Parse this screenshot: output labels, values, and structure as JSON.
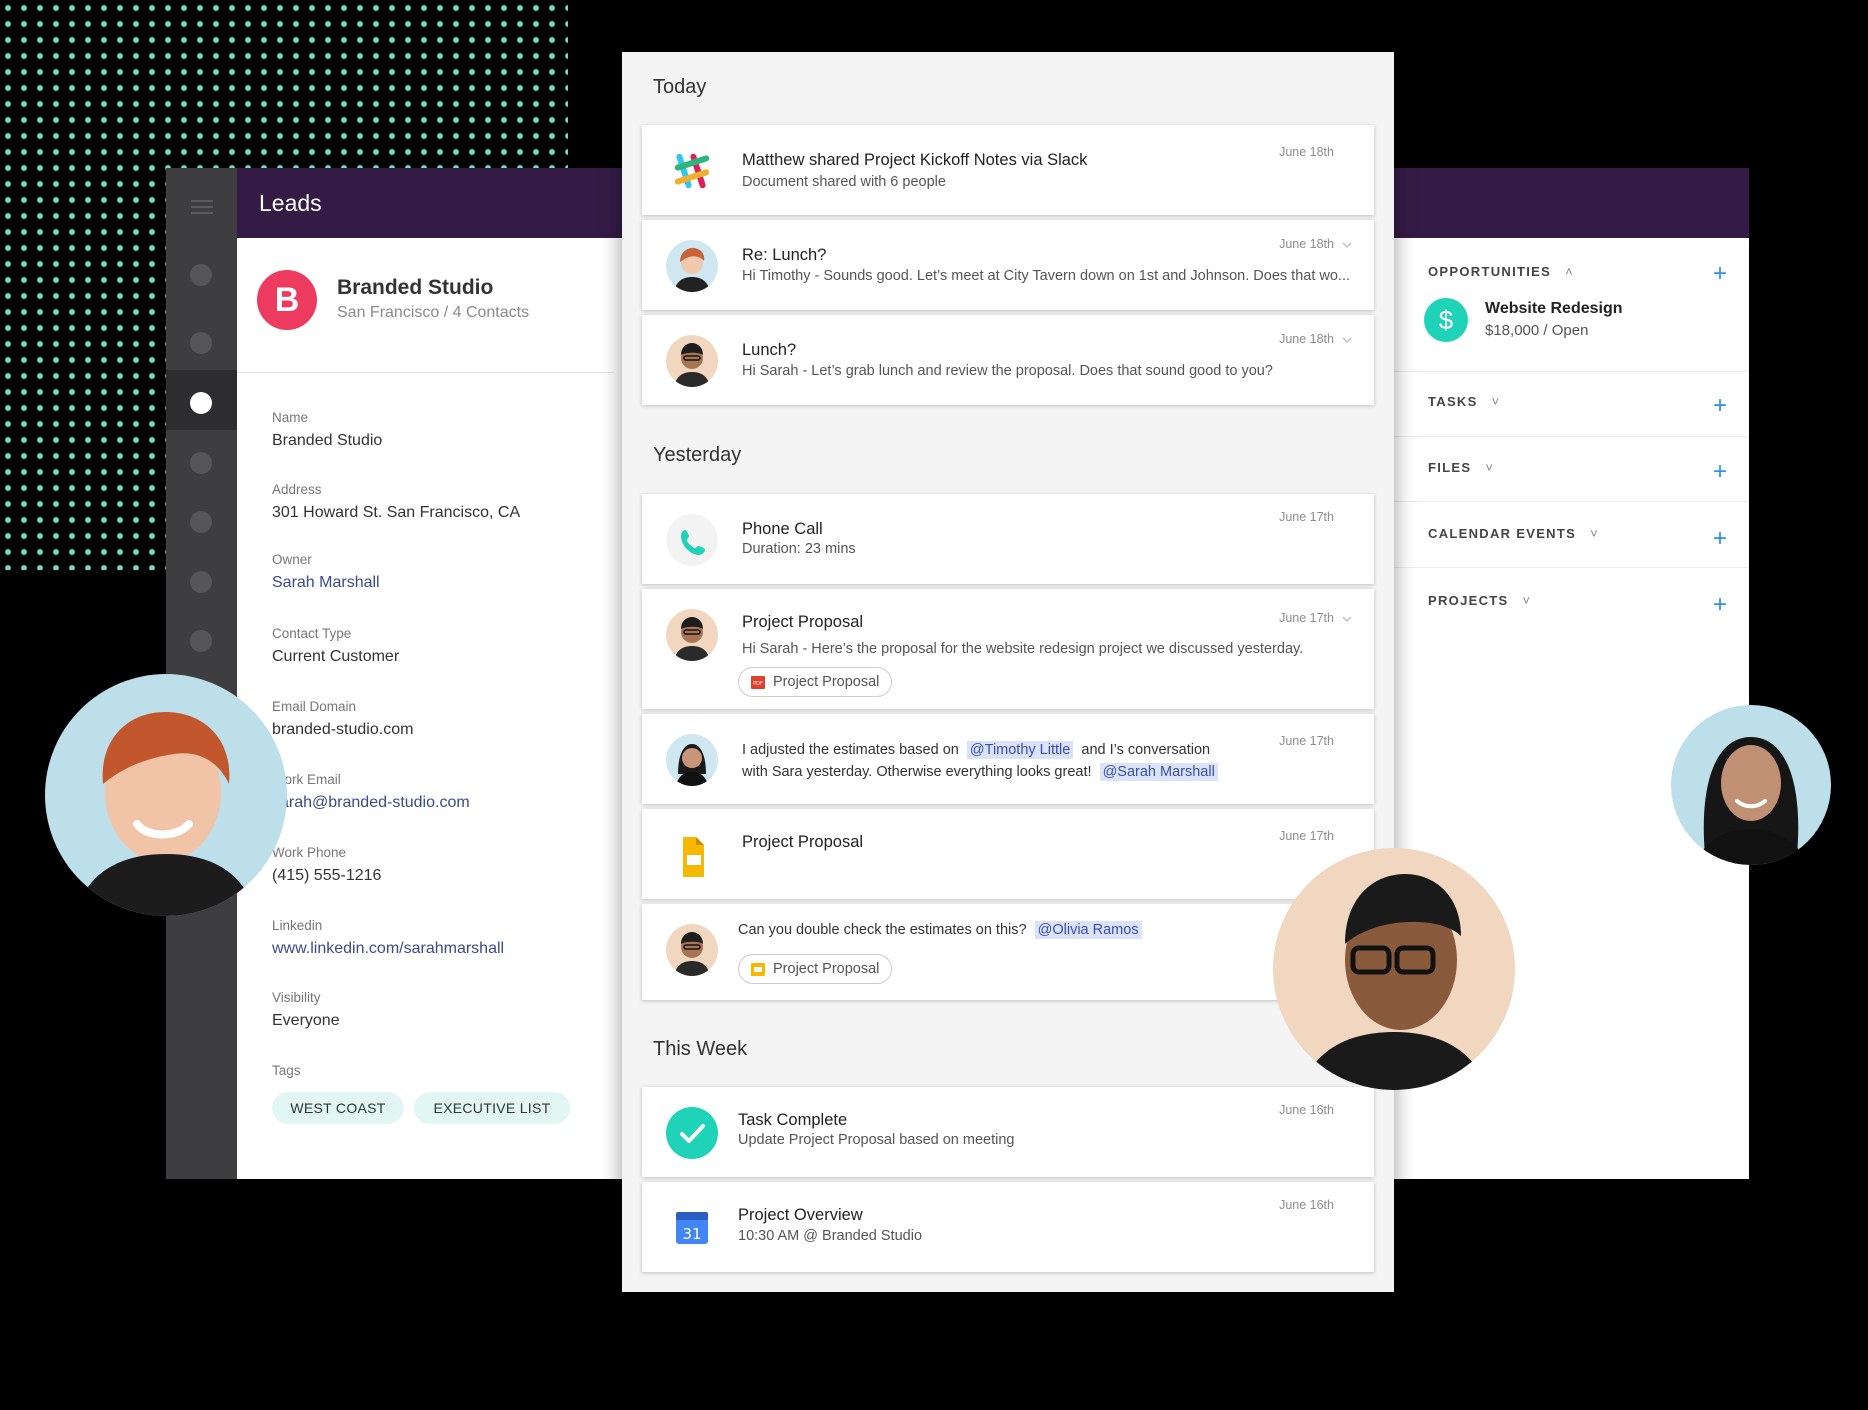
{
  "leads": {
    "header_title": "Leads",
    "company": {
      "initial": "B",
      "name": "Branded Studio",
      "subtitle": "San Francisco / 4 Contacts"
    },
    "fields": [
      {
        "label": "Name",
        "value": "Branded Studio",
        "link": false
      },
      {
        "label": "Address",
        "value": "301 Howard St. San Francisco, CA",
        "link": false
      },
      {
        "label": "Owner",
        "value": "Sarah Marshall",
        "link": true
      },
      {
        "label": "Contact Type",
        "value": "Current Customer",
        "link": false
      },
      {
        "label": "Email Domain",
        "value": "branded-studio.com",
        "link": false
      },
      {
        "label": "Work Email",
        "value": "sarah@branded-studio.com",
        "link": true
      },
      {
        "label": "Work Phone",
        "value": "(415) 555-1216",
        "link": false
      },
      {
        "label": "Linkedin",
        "value": "www.linkedin.com/sarahmarshall",
        "link": true
      },
      {
        "label": "Visibility",
        "value": "Everyone",
        "link": false
      }
    ],
    "tags_label": "Tags",
    "tags": [
      "WEST COAST",
      "EXECUTIVE LIST"
    ]
  },
  "feed": {
    "sections": [
      "Today",
      "Yesterday",
      "This Week"
    ],
    "items": [
      {
        "title": "Matthew shared Project Kickoff Notes via Slack",
        "sub": "Document shared with 6 people",
        "date": "June 18th",
        "icon": "slack-icon"
      },
      {
        "title": "Re: Lunch?",
        "sub": "Hi Timothy -  Sounds good. Let’s meet at City Tavern down on 1st and Johnson. Does that wo...",
        "date": "June 18th",
        "icon": "avatar-woman-red"
      },
      {
        "title": "Lunch?",
        "sub": "Hi Sarah - Let’s grab lunch and review the proposal. Does that sound good to you?",
        "date": "June 18th",
        "icon": "avatar-man"
      },
      {
        "title": "Phone Call",
        "sub": "Duration: 23 mins",
        "date": "June 17th",
        "icon": "phone-icon"
      },
      {
        "title": "Project Proposal",
        "sub": "Hi Sarah - Here’s the proposal for the website redesign project we discussed yesterday.",
        "date": "June 17th",
        "attachment": "Project Proposal",
        "icon": "avatar-man"
      },
      {
        "text_a": "I adjusted the estimates based on",
        "mention_a": "@Timothy Little",
        "text_b": "and I’s conversation",
        "text_c": "with Sara yesterday. Otherwise everything looks great!",
        "mention_b": "@Sarah Marshall",
        "date": "June 17th",
        "icon": "avatar-woman-dark"
      },
      {
        "title": "Project Proposal",
        "date": "June 17th",
        "icon": "slides-icon"
      },
      {
        "text_a": "Can you double check the estimates on this?",
        "mention_a": "@Olivia Ramos",
        "attachment": "Project Proposal",
        "icon": "avatar-man"
      },
      {
        "title": "Task Complete",
        "sub": "Update Project Proposal based on meeting",
        "date": "June 16th",
        "icon": "check-icon"
      },
      {
        "title": "Project Overview",
        "sub": "10:30 AM @ Branded Studio",
        "date": "June 16th",
        "icon": "calendar-icon",
        "calendar_day": "31"
      }
    ]
  },
  "right": {
    "opportunities_label": "OPPORTUNITIES",
    "opportunity": {
      "name": "Website Redesign",
      "detail": "$18,000 / Open"
    },
    "sections": [
      "TASKS",
      "FILES",
      "CALENDAR EVENTS",
      "PROJECTS"
    ]
  },
  "colors": {
    "header": "#341b45",
    "accent_teal": "#1ed3b8",
    "brand_red": "#ec3b5f",
    "link": "#3a4a8d"
  }
}
